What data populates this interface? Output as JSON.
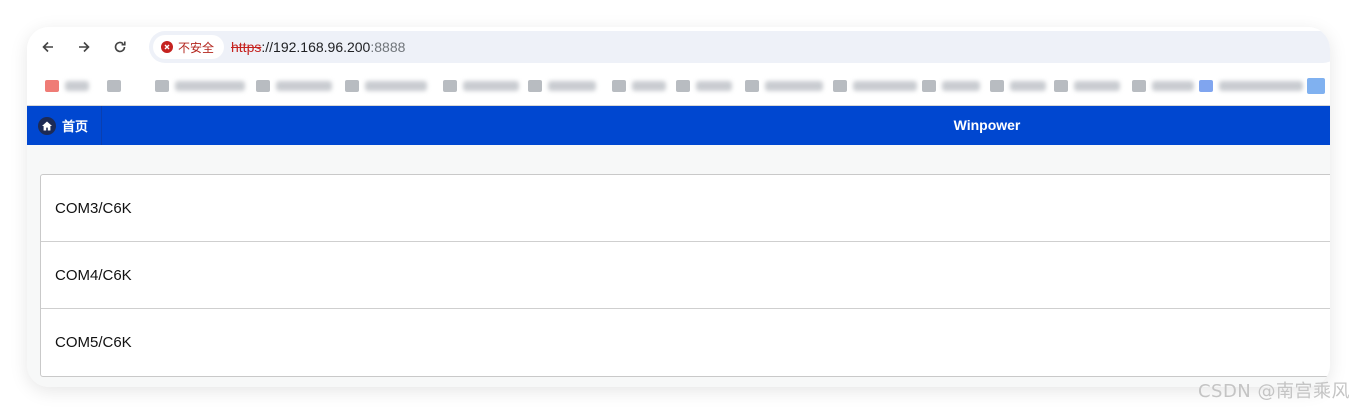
{
  "browser": {
    "security_label": "不安全",
    "url_scheme": "https",
    "url_separator": "://",
    "url_host": "192.168.96.200",
    "url_port": ":8888",
    "icons": [
      "back-arrow-icon",
      "forward-arrow-icon",
      "reload-icon",
      "warning-icon"
    ]
  },
  "header": {
    "home_label": "首页",
    "home_icon": "home-icon",
    "brand": "Winpower",
    "bg_color": "#0047d0"
  },
  "ports": [
    {
      "label": "COM3/C6K"
    },
    {
      "label": "COM4/C6K"
    },
    {
      "label": "COM5/C6K"
    }
  ],
  "watermark": "CSDN @南宫乘风"
}
